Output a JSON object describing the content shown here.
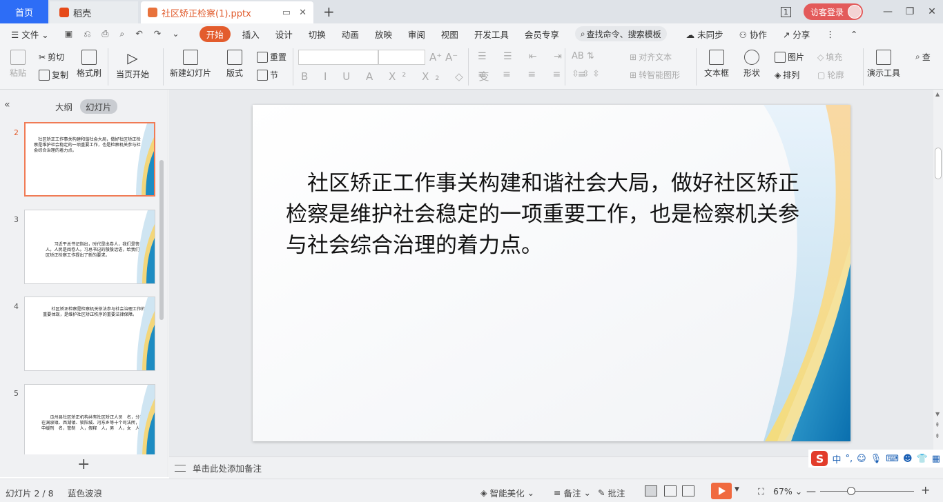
{
  "titlebar": {
    "home": "首页",
    "wps_tab": "稻壳",
    "doc_tab": "社区矫正检察(1).pptx",
    "user_label": "访客登录",
    "page_badge": "1"
  },
  "menu": {
    "file": "文件",
    "tabs": [
      "开始",
      "插入",
      "设计",
      "切换",
      "动画",
      "放映",
      "审阅",
      "视图",
      "开发工具",
      "会员专享"
    ],
    "search": "查找命令、搜索模板",
    "right": [
      "未同步",
      "协作",
      "分享"
    ]
  },
  "ribbon": {
    "paste": "粘贴",
    "cut": "剪切",
    "copy": "复制",
    "format_painter": "格式刷",
    "from_current": "当页开始",
    "new_slide": "新建幻灯片",
    "layout": "版式",
    "reset": "重置",
    "section": "节",
    "align_text": "对齐文本",
    "smartart": "转智能图形",
    "textbox": "文本框",
    "shape": "形状",
    "picture": "图片",
    "arrange": "排列",
    "fill": "填充",
    "outline": "轮廓",
    "present_tools": "演示工具",
    "find": "查"
  },
  "leftpane": {
    "outline_tab": "大纲",
    "slides_tab": "幻灯片",
    "thumbs": [
      {
        "num": "2",
        "text": "　社区矫正工作事关构建和谐社会大局，做好社区矫正检察是维护社会稳定的一项重要工作，也是检察机关参与社会综合治理的着力点。"
      },
      {
        "num": "3",
        "text": "　　习近平总书记指出，时代是出卷人，我们是答卷人，人民是阅卷人。习总书记的殷殷话语，给我们社区矫正检察工作提出了新的要求。"
      },
      {
        "num": "4",
        "text": "　　社区矫正检察是检察机关依法参与社会治理工作的重要体现，是维护社区矫正秩序的重要法律保障。"
      },
      {
        "num": "5",
        "text": "　　瓜州县社区矫正机构共有社区矫正人员　名，分布在渊泉镇、西湖镇、锁阳城、河东乡等十个司法所，其中缓刑　名，管制　人，假释　人，男　人，女　人。"
      }
    ]
  },
  "slide": {
    "text": "　社区矫正工作事关构建和谐社会大局，做好社区矫正检察是维护社会稳定的一项重要工作，也是检察机关参与社会综合治理的着力点。"
  },
  "notes": {
    "placeholder": "单击此处添加备注"
  },
  "ime": {
    "items": [
      "中",
      "°,"
    ]
  },
  "status": {
    "slide_pos": "幻灯片 2 / 8",
    "theme": "蓝色波浪",
    "beautify": "智能美化",
    "notes": "备注",
    "comments": "批注",
    "zoom": "67%"
  },
  "colors": {
    "accent": "#e35c2d",
    "home_tab": "#2d6df6",
    "wave_blue": "#1a8fc4",
    "wave_yellow": "#f5d98a"
  }
}
